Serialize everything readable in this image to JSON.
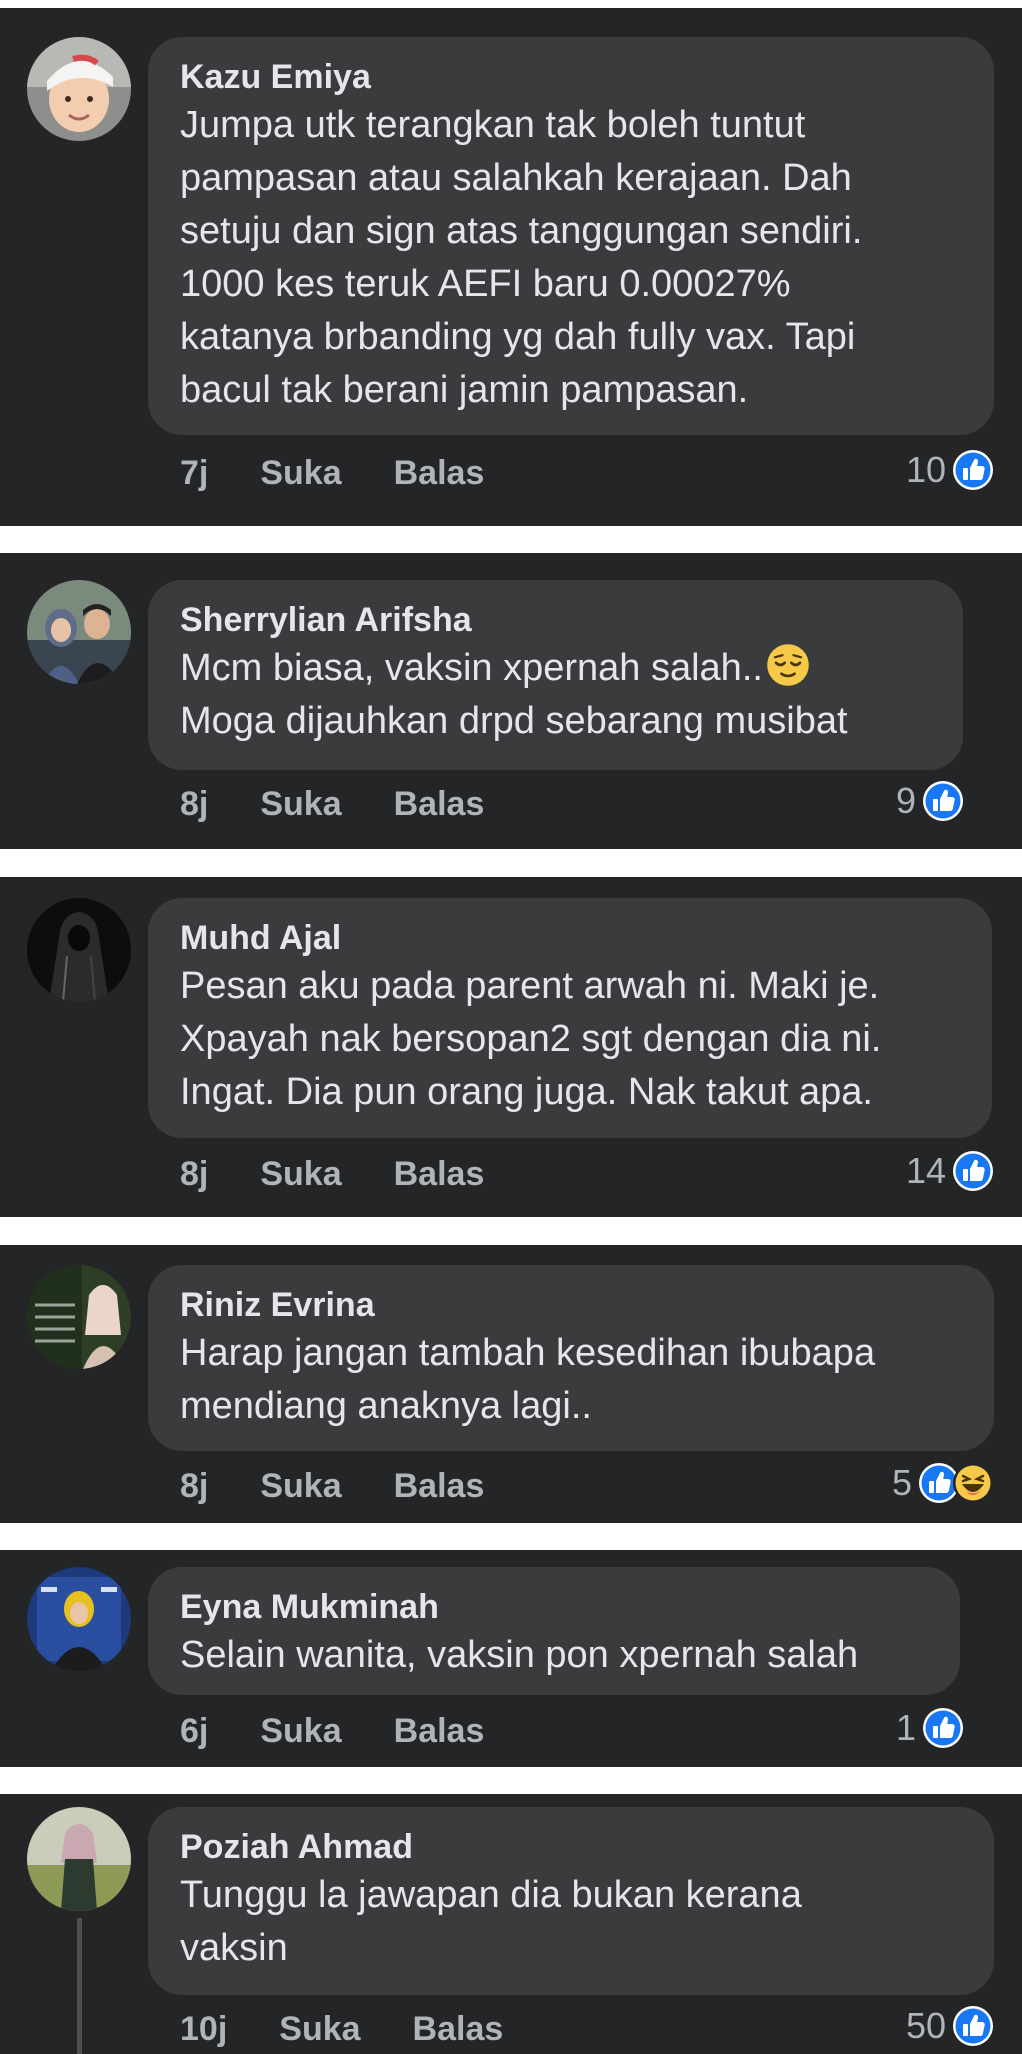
{
  "comments": [
    {
      "author": "Kazu Emiya",
      "text": "Jumpa utk terangkan tak boleh tuntut\npampasan atau salahkah kerajaan. Dah\nsetuju dan sign atas tanggungan sendiri.\n1000 kes teruk AEFI baru 0.00027%\nkatanya brbanding yg dah fully vax. Tapi\nbacul tak berani jamin pampasan.",
      "time": "7j",
      "like_label": "Suka",
      "reply_label": "Balas",
      "reaction_count": "10",
      "reactions": [
        "like-reaction-icon"
      ]
    },
    {
      "author": "Sherrylian Arifsha",
      "text": "Mcm biasa, vaksin xpernah salah..",
      "text2": "Moga dijauhkan drpd sebarang musibat",
      "inline_emoji": "relieved-face-emoji",
      "time": "8j",
      "like_label": "Suka",
      "reply_label": "Balas",
      "reaction_count": "9",
      "reactions": [
        "like-reaction-icon"
      ]
    },
    {
      "author": "Muhd Ajal",
      "text": "Pesan aku pada parent arwah ni. Maki je.\nXpayah nak bersopan2 sgt dengan dia ni.\nIngat. Dia pun orang juga. Nak takut apa.",
      "time": "8j",
      "like_label": "Suka",
      "reply_label": "Balas",
      "reaction_count": "14",
      "reactions": [
        "like-reaction-icon"
      ]
    },
    {
      "author": "Riniz Evrina",
      "text": "Harap jangan tambah kesedihan ibubapa\nmendiang anaknya lagi..",
      "time": "8j",
      "like_label": "Suka",
      "reply_label": "Balas",
      "reaction_count": "5",
      "reactions": [
        "like-reaction-icon",
        "haha-reaction-icon"
      ]
    },
    {
      "author": "Eyna Mukminah",
      "text": "Selain wanita, vaksin pon xpernah salah",
      "time": "6j",
      "like_label": "Suka",
      "reply_label": "Balas",
      "reaction_count": "1",
      "reactions": [
        "like-reaction-icon"
      ]
    },
    {
      "author": "Poziah Ahmad",
      "text": "Tunggu la jawapan dia bukan kerana\nvaksin",
      "time": "10j",
      "like_label": "Suka",
      "reply_label": "Balas",
      "reaction_count": "50",
      "reactions": [
        "like-reaction-icon"
      ]
    }
  ],
  "colors": {
    "card_bg": "#242526",
    "bubble_bg": "#3a3b3c",
    "text": "#e4e6eb",
    "secondary_text": "#b0b3b8",
    "like_blue": "#1877f2",
    "separator": "#ffffff"
  }
}
